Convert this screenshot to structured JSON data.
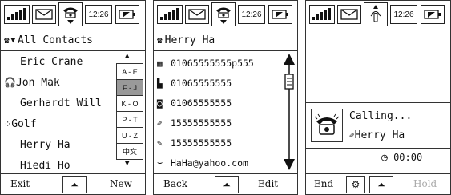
{
  "status": {
    "time": "12:26"
  },
  "screen1": {
    "title": "All Contacts",
    "contacts": [
      {
        "name": "Eric Crane",
        "icon": ""
      },
      {
        "name": "Jon Mak",
        "icon": "headset-icon"
      },
      {
        "name": "Gerhardt Will",
        "icon": ""
      },
      {
        "name": "Golf",
        "icon": "group-icon"
      },
      {
        "name": "Herry Ha",
        "icon": ""
      },
      {
        "name": "Hiedi Ho",
        "icon": ""
      }
    ],
    "index": [
      {
        "label": "A - E",
        "selected": false
      },
      {
        "label": "F - J",
        "selected": true
      },
      {
        "label": "K - O",
        "selected": false
      },
      {
        "label": "P - T",
        "selected": false
      },
      {
        "label": "U - Z",
        "selected": false
      },
      {
        "label": "中文",
        "selected": false
      }
    ],
    "left_soft": "Exit",
    "right_soft": "New"
  },
  "screen2": {
    "title": "Herry Ha",
    "details": [
      {
        "icon": "office-phone-icon",
        "value": "01065555555p555"
      },
      {
        "icon": "home-phone-icon",
        "value": "01065555555"
      },
      {
        "icon": "fax-icon",
        "value": "01065555555"
      },
      {
        "icon": "mobile-icon",
        "value": "15555555555"
      },
      {
        "icon": "mobile-2-icon",
        "value": "15555555555"
      },
      {
        "icon": "email-icon",
        "value": "HaHa@yahoo.com"
      }
    ],
    "left_soft": "Back",
    "right_soft": "Edit"
  },
  "screen3": {
    "status_text": "Calling...",
    "contact_name": "Herry Ha",
    "timer": "00:00",
    "left_soft": "End",
    "right_soft": "Hold"
  }
}
